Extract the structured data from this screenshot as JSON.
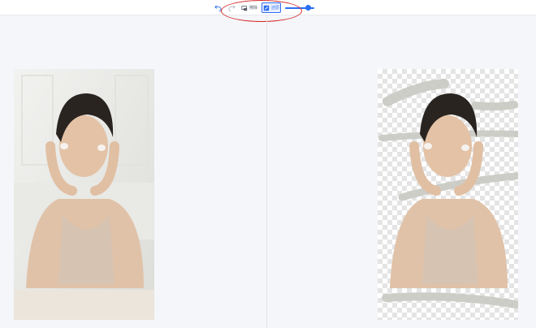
{
  "toolbar": {
    "undo_icon": "undo-icon",
    "redo_icon": "redo-icon",
    "erase": {
      "icon": "eraser-icon",
      "label": "擦除"
    },
    "restore": {
      "icon": "brush-restore-icon",
      "label": "还原"
    },
    "brush_size": {
      "level": 0.85
    }
  },
  "colors": {
    "accent": "#2c6df2",
    "annotation": "#d62b2b",
    "page_bg": "#f4f6f9"
  },
  "canvases": {
    "original": {
      "name": "original-image"
    },
    "result": {
      "name": "result-image"
    }
  }
}
